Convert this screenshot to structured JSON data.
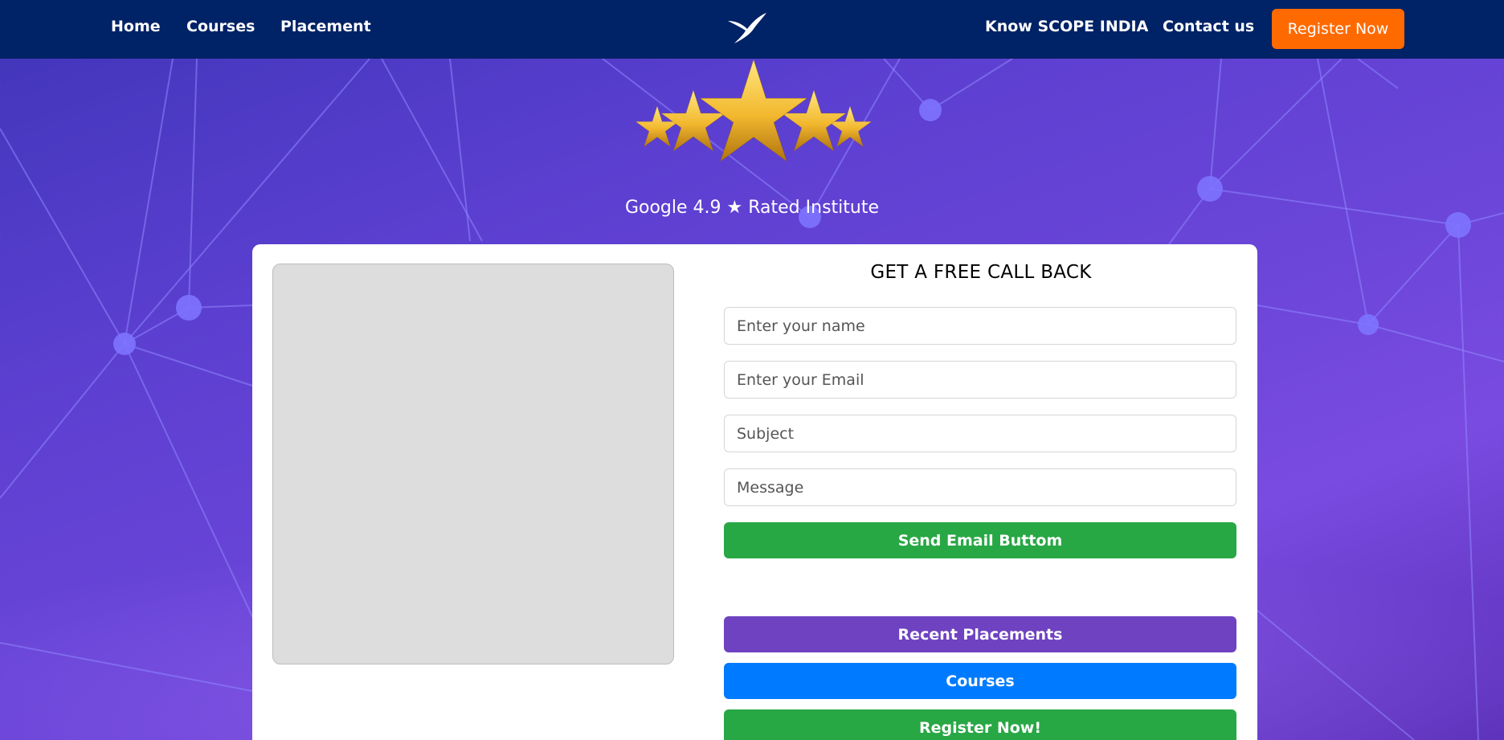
{
  "nav": {
    "left_links": [
      "Home",
      "Courses",
      "Placement"
    ],
    "right_links": [
      "Know SCOPE INDIA",
      "Contact us"
    ],
    "register_label": "Register Now",
    "logo_icon": "bird-logo-icon",
    "colors": {
      "bar": "#002266",
      "register": "#ff6a00"
    }
  },
  "hero": {
    "rating_text": "Google 4.9 ★ Rated Institute",
    "stars_icon": "five-gold-stars-icon"
  },
  "form": {
    "title": "GET A FREE CALL BACK",
    "fields": [
      {
        "placeholder": "Enter your name"
      },
      {
        "placeholder": "Enter your Email"
      },
      {
        "placeholder": "Subject"
      },
      {
        "placeholder": "Message"
      }
    ],
    "submit_label": "Send Email Buttom"
  },
  "quick_links": [
    {
      "label": "Recent Placements",
      "color": "#6f42c1"
    },
    {
      "label": "Courses",
      "color": "#007bff"
    },
    {
      "label": "Register Now!",
      "color": "#28a745"
    }
  ],
  "colors": {
    "submit": "#28a745"
  }
}
